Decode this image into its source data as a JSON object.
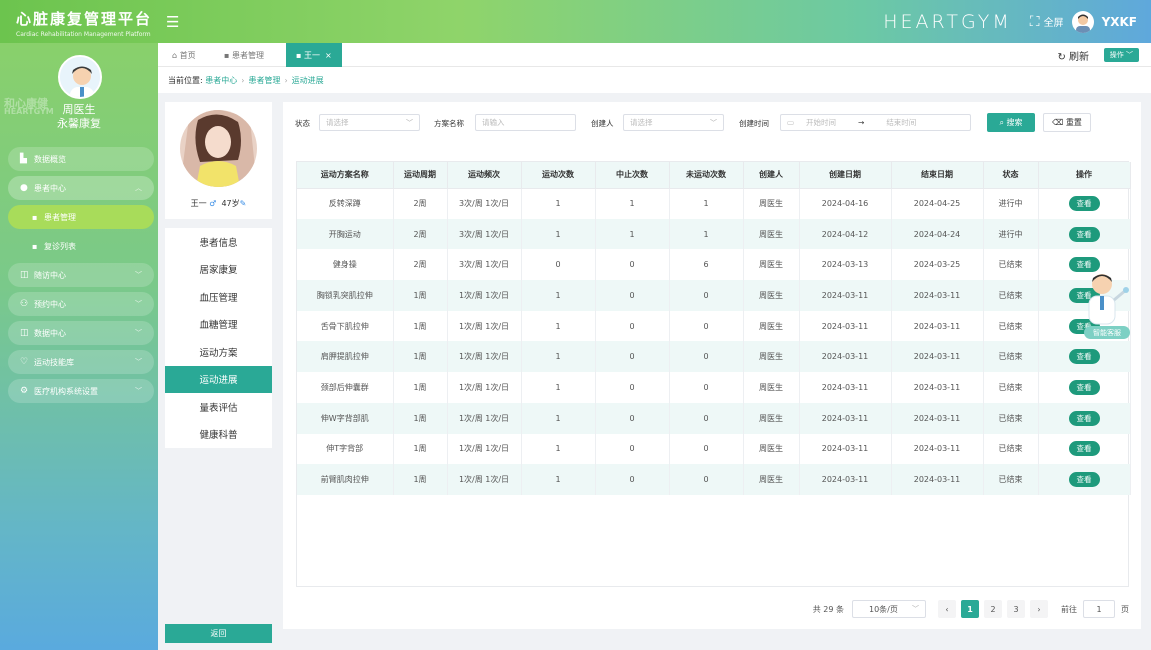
{
  "header": {
    "title": "心脏康复管理平台",
    "subtitle": "Cardiac Rehabilitation Management Platform",
    "brand_logo": "HEARTGYM",
    "fullscreen_label": "全屏",
    "username": "YXKF"
  },
  "sidebar": {
    "doctor_name": "周医生",
    "org_name": "永馨康复",
    "watermark": "和心康健",
    "watermark_en": "HEARTGYM",
    "items": [
      {
        "label": "数据概览",
        "icon": "bar-chart-icon"
      },
      {
        "label": "患者中心",
        "icon": "user-icon",
        "open": true
      },
      {
        "label": "患者管理",
        "icon": "grid-icon",
        "sub": true,
        "active": true
      },
      {
        "label": "复诊列表",
        "icon": "grid-icon",
        "sub": true
      },
      {
        "label": "随访中心",
        "icon": "book-icon"
      },
      {
        "label": "预约中心",
        "icon": "users-icon"
      },
      {
        "label": "数据中心",
        "icon": "monitor-icon"
      },
      {
        "label": "运动技能库",
        "icon": "heart-icon"
      },
      {
        "label": "医疗机构系统设置",
        "icon": "gear-icon"
      }
    ]
  },
  "tabs": {
    "home": "首页",
    "patient_mgmt": "患者管理",
    "current": "王一",
    "refresh": "刷新",
    "operate": "操作"
  },
  "breadcrumb": {
    "prefix": "当前位置:",
    "items": [
      "患者中心",
      "患者管理",
      "运动进展"
    ]
  },
  "patient": {
    "name": "王一",
    "gender_symbol": "♂",
    "age": "47岁"
  },
  "patient_nav": [
    "患者信息",
    "居家康复",
    "血压管理",
    "血糖管理",
    "运动方案",
    "运动进展",
    "量表评估",
    "健康科普"
  ],
  "back_label": "返回",
  "filters": {
    "status_label": "状态",
    "status_placeholder": "请选择",
    "plan_label": "方案名称",
    "plan_placeholder": "请输入",
    "creator_label": "创建人",
    "creator_placeholder": "请选择",
    "created_label": "创建时间",
    "start_placeholder": "开始时间",
    "end_placeholder": "结束时间",
    "search": "搜索",
    "reset": "重置"
  },
  "table": {
    "headers": [
      "运动方案名称",
      "运动周期",
      "运动频次",
      "运动次数",
      "中止次数",
      "未运动次数",
      "创建人",
      "创建日期",
      "结束日期",
      "状态",
      "操作"
    ],
    "view_label": "查看",
    "rows": [
      [
        "反转深蹲",
        "2周",
        "3次/周 1次/日",
        "1",
        "1",
        "1",
        "周医生",
        "2024-04-16",
        "2024-04-25",
        "进行中"
      ],
      [
        "开胸运动",
        "2周",
        "3次/周 1次/日",
        "1",
        "1",
        "1",
        "周医生",
        "2024-04-12",
        "2024-04-24",
        "进行中"
      ],
      [
        "健身操",
        "2周",
        "3次/周 1次/日",
        "0",
        "0",
        "6",
        "周医生",
        "2024-03-13",
        "2024-03-25",
        "已结束"
      ],
      [
        "胸锁乳突肌拉伸",
        "1周",
        "1次/周 1次/日",
        "1",
        "0",
        "0",
        "周医生",
        "2024-03-11",
        "2024-03-11",
        "已结束"
      ],
      [
        "舌骨下肌拉伸",
        "1周",
        "1次/周 1次/日",
        "1",
        "0",
        "0",
        "周医生",
        "2024-03-11",
        "2024-03-11",
        "已结束"
      ],
      [
        "肩胛提肌拉伸",
        "1周",
        "1次/周 1次/日",
        "1",
        "0",
        "0",
        "周医生",
        "2024-03-11",
        "2024-03-11",
        "已结束"
      ],
      [
        "颈部后伸囊群",
        "1周",
        "1次/周 1次/日",
        "1",
        "0",
        "0",
        "周医生",
        "2024-03-11",
        "2024-03-11",
        "已结束"
      ],
      [
        "伸W字背部肌",
        "1周",
        "1次/周 1次/日",
        "1",
        "0",
        "0",
        "周医生",
        "2024-03-11",
        "2024-03-11",
        "已结束"
      ],
      [
        "伸T字背部",
        "1周",
        "1次/周 1次/日",
        "1",
        "0",
        "0",
        "周医生",
        "2024-03-11",
        "2024-03-11",
        "已结束"
      ],
      [
        "前臂肌肉拉伸",
        "1周",
        "1次/周 1次/日",
        "1",
        "0",
        "0",
        "周医生",
        "2024-03-11",
        "2024-03-11",
        "已结束"
      ]
    ]
  },
  "pagination": {
    "total": "共 29 条",
    "page_size": "10条/页",
    "pages": [
      "1",
      "2",
      "3"
    ],
    "current_page": "1",
    "goto_label": "前往",
    "goto_value": "1",
    "page_unit": "页"
  },
  "assistant": {
    "label": "智能客服"
  },
  "colors": {
    "accent": "#2aa996",
    "view_button": "#1e9a7c",
    "row_alt": "#eef8f7"
  }
}
